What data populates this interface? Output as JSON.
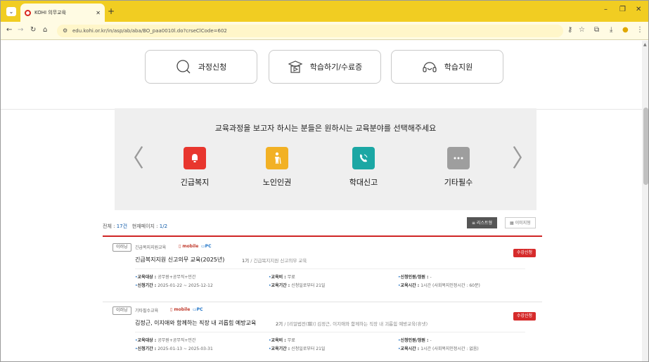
{
  "browser": {
    "tab_title": "KOHI 의무교육",
    "url": "edu.kohi.or.kr/in/asp/ab/aba/BO_paa0010l.do?crseClCode=602"
  },
  "quick": {
    "apply": "과정신청",
    "learn": "학습하기/수료증",
    "support": "학습지원"
  },
  "panel": {
    "title": "교육과정을 보고자 하시는 분들은 원하시는 교육분야를 선택해주세요",
    "categories": [
      {
        "label": "긴급복지",
        "color": "#e8362e",
        "icon": "bell-icon"
      },
      {
        "label": "노인인권",
        "color": "#f2b125",
        "icon": "person-icon"
      },
      {
        "label": "학대신고",
        "color": "#1ba7a4",
        "icon": "phone-icon"
      },
      {
        "label": "기타필수",
        "color": "#9e9e9e",
        "icon": "more-icon"
      }
    ]
  },
  "list": {
    "total_label": "전체 : ",
    "total_value": "17건",
    "page_label": "현재페이지 : ",
    "page_value": "1/2",
    "view_list": "≡ 리스트형",
    "view_image": "▦ 이미지형",
    "items": [
      {
        "badge": "이러닝",
        "category": "긴급복지지원교육",
        "mobile": "mobile",
        "pc": "PC",
        "title": "긴급복지지원 신고의무 교육(2025년)",
        "term": "1기",
        "subtitle": "/ 긴급복지지원 신고의무 교육",
        "apply": "수강신청",
        "target_label": "교육대상 : ",
        "target": "공무원+공무직+민간",
        "fee_label": "교육비 : ",
        "fee": "무료",
        "quota_label": "신청인원/정원 : ",
        "quota": "-",
        "period_label": "신청기간 : ",
        "period": "2025-01-22 ~ 2025-12-12",
        "study_label": "교육기간 : ",
        "study": "신청일로부터 21일",
        "hours_label": "교육시간 : ",
        "hours": "1시간 (사회복지인정시간 : 60분)"
      },
      {
        "badge": "이러닝",
        "category": "기타필수교육",
        "mobile": "mobile",
        "pc": "PC",
        "title": "김정근, 이지애와 함께하는 직장 내 괴롭힘 예방교육",
        "term": "2기",
        "subtitle": "/ [리얼법전(職)] 김정근, 이지애와 함께하는 직장 내 괴롭힘 예방교육(휴넷)",
        "apply": "수강신청",
        "target_label": "교육대상 : ",
        "target": "공무원+공무직+민간",
        "fee_label": "교육비 : ",
        "fee": "무료",
        "quota_label": "신청인원/정원 : ",
        "quota": "-",
        "period_label": "신청기간 : ",
        "period": "2025-01-13 ~ 2025-03-31",
        "study_label": "교육기간 : ",
        "study": "신청일로부터 21일",
        "hours_label": "교육시간 : ",
        "hours": "1시간 (사회복지인정시간 : 없음)"
      }
    ]
  },
  "colors": {
    "chrome": "#f1cd22",
    "accent_red": "#d62b2b",
    "link_blue": "#0b57a8"
  }
}
